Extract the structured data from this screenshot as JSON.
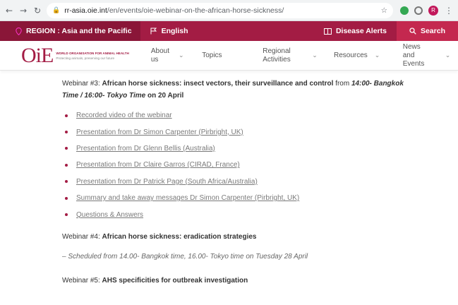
{
  "browser": {
    "url_host": "rr-asia.oie.int",
    "url_path": "/en/events/oie-webinar-on-the-african-horse-sickness/",
    "profile_initial": "R"
  },
  "topbar": {
    "region_label": "REGION : Asia and the Pacific",
    "language_label": "English",
    "alerts_label": "Disease Alerts",
    "search_label": "Search"
  },
  "logo": {
    "mark": "OiE",
    "line1": "WORLD ORGANISATION FOR ANIMAL HEALTH",
    "line2": "Protecting animals, preserving our future"
  },
  "nav": {
    "about": "About us",
    "topics": "Topics",
    "regional": "Regional Activities",
    "resources": "Resources",
    "news": "News and Events"
  },
  "webinar3": {
    "prefix": "Webinar #3: ",
    "title": "African horse sickness: insect vectors, their surveillance and control",
    "from": " from ",
    "time": "14:00- Bangkok Time / 16:00- Tokyo Time",
    "date": " on 20 April"
  },
  "links": [
    "Recorded video of the webinar",
    "Presentation from Dr Simon Carpenter (Pirbright, UK)",
    "Presentation from Dr Glenn Bellis (Australia)",
    "Presentation from Dr Claire Garros (CIRAD, France)",
    "Presentation from Dr Patrick Page (South Africa/Australia)",
    "Summary and take away messages Dr Simon Carpenter (Pirbright, UK)",
    "Questions & Answers"
  ],
  "webinar4": {
    "prefix": "Webinar #4: ",
    "title": "African horse sickness: eradication strategies",
    "schedule": "– Scheduled from 14.00- Bangkok time, 16.00- Tokyo time on Tuesday 28 April"
  },
  "webinar5": {
    "prefix": "Webinar #5: ",
    "title": "AHS specificities for outbreak investigation"
  },
  "colors": {
    "brand": "#a31c44",
    "region_bg": "#8a1638",
    "search_bg": "#c4284f"
  }
}
